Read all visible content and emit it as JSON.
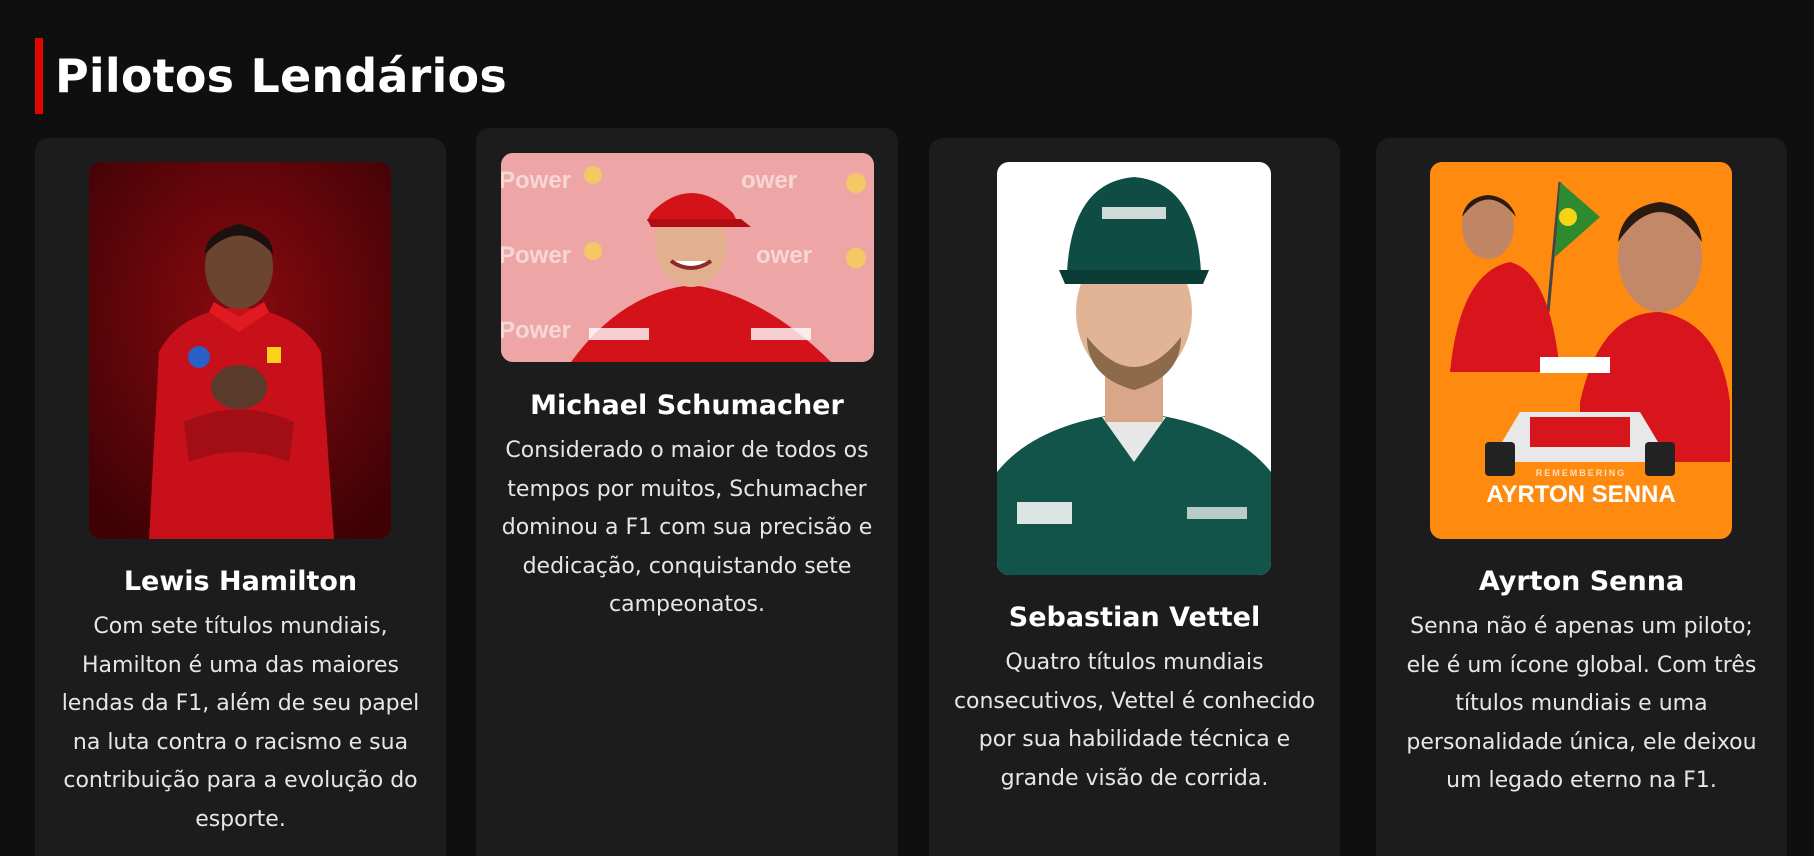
{
  "section": {
    "title": "Pilotos Lendários",
    "accent_color": "#e10600"
  },
  "drivers": [
    {
      "name": "Lewis Hamilton",
      "description": "Com sete títulos mundiais, Hamilton é uma das maiores lendas da F1, além de seu papel na luta contra o racismo e sua contribuição para a evolução do esporte.",
      "photo_icon": "lewis-hamilton-photo"
    },
    {
      "name": "Michael Schumacher",
      "description": "Considerado o maior de todos os tempos por muitos, Schumacher dominou a F1 com sua precisão e dedicação, conquistando sete campeonatos.",
      "photo_icon": "michael-schumacher-photo",
      "photo_text": "Power"
    },
    {
      "name": "Sebastian Vettel",
      "description": "Quatro títulos mundiais consecutivos, Vettel é conhecido por sua habilidade técnica e grande visão de corrida.",
      "photo_icon": "sebastian-vettel-photo"
    },
    {
      "name": "Ayrton Senna",
      "description": "Senna não é apenas um piloto; ele é um ícone global. Com três títulos mundiais e uma personalidade única, ele deixou um legado eterno na F1.",
      "photo_icon": "ayrton-senna-photo",
      "photo_caption_small": "REMEMBERING",
      "photo_caption": "AYRTON SENNA"
    }
  ]
}
